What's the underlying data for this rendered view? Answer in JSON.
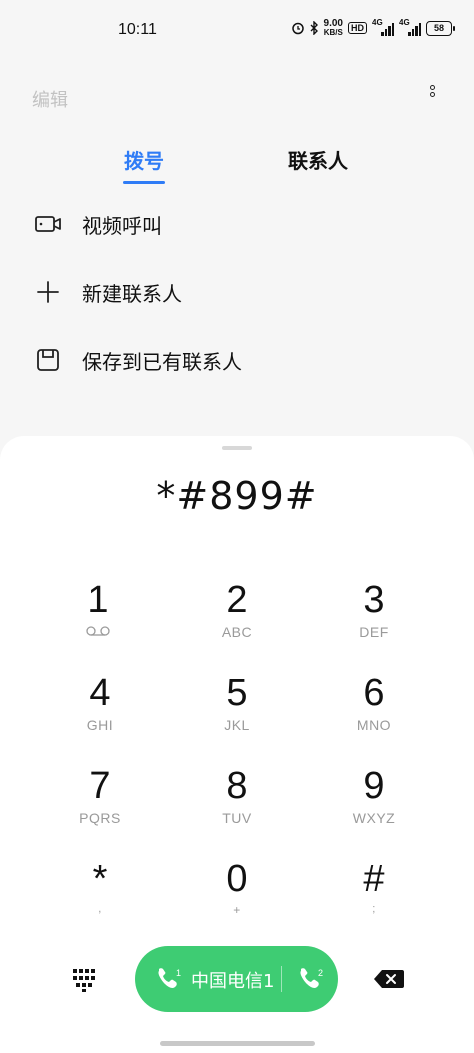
{
  "status_bar": {
    "time": "10:11",
    "net_speed_value": "9.00",
    "net_speed_unit": "KB/S",
    "hd": "HD",
    "sim1_label": "4G",
    "sim2_label": "4G",
    "battery": "58"
  },
  "header": {
    "edit_label": "编辑"
  },
  "tabs": [
    {
      "label": "拨号",
      "active": true
    },
    {
      "label": "联系人",
      "active": false
    }
  ],
  "actions": [
    {
      "icon": "video-camera-icon",
      "label": "视频呼叫"
    },
    {
      "icon": "plus-icon",
      "label": "新建联系人"
    },
    {
      "icon": "save-icon",
      "label": "保存到已有联系人"
    }
  ],
  "dialer": {
    "number": "*#899#",
    "keys": [
      {
        "digit": "1",
        "sub": ""
      },
      {
        "digit": "2",
        "sub": "ABC"
      },
      {
        "digit": "3",
        "sub": "DEF"
      },
      {
        "digit": "4",
        "sub": "GHI"
      },
      {
        "digit": "5",
        "sub": "JKL"
      },
      {
        "digit": "6",
        "sub": "MNO"
      },
      {
        "digit": "7",
        "sub": "PQRS"
      },
      {
        "digit": "8",
        "sub": "TUV"
      },
      {
        "digit": "9",
        "sub": "WXYZ"
      },
      {
        "digit": "*",
        "sub": ","
      },
      {
        "digit": "0",
        "sub": "+"
      },
      {
        "digit": "#",
        "sub": ";"
      }
    ],
    "call_button": {
      "carrier": "中国电信1",
      "sim1_badge": "1",
      "sim2_badge": "2"
    }
  },
  "colors": {
    "accent": "#2f7cf6",
    "call_green": "#3ecc73"
  }
}
